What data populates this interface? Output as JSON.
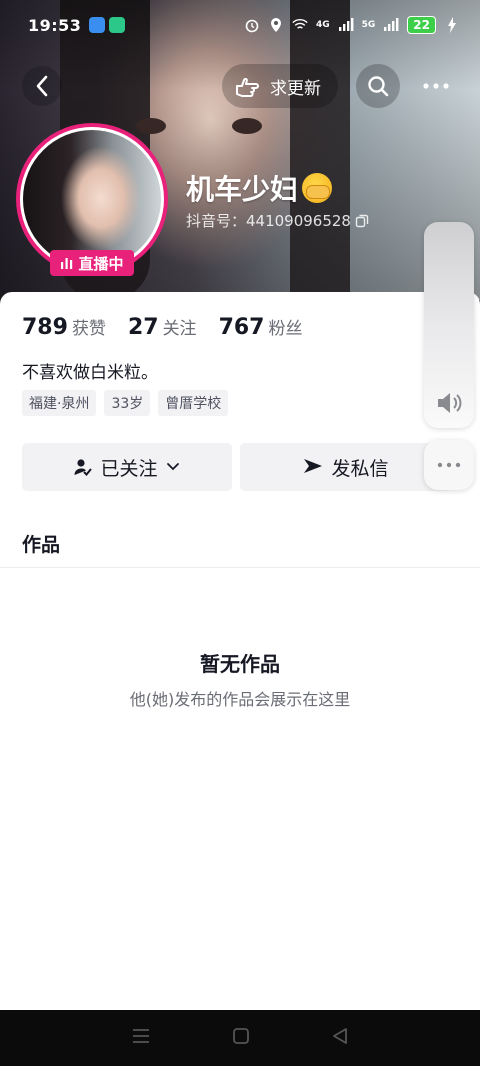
{
  "status_bar": {
    "time": "19:53",
    "battery": "22",
    "network_a": "4G",
    "network_b": "5G"
  },
  "nav": {
    "update_label": "求更新"
  },
  "profile": {
    "live_badge": "直播中",
    "nickname": "机车少妇",
    "douyin_id": "抖音号：44109096528"
  },
  "stats": [
    {
      "num": "789",
      "label": "获赞"
    },
    {
      "num": "27",
      "label": "关注"
    },
    {
      "num": "767",
      "label": "粉丝"
    }
  ],
  "bio": "不喜欢做白米粒。",
  "tags": [
    "福建·泉州",
    "33岁",
    "曾厝学校"
  ],
  "actions": {
    "follow_label": "已关注",
    "message_label": "发私信"
  },
  "works": {
    "tab_label": "作品",
    "empty_title": "暂无作品",
    "empty_subtitle": "他(她)发布的作品会展示在这里"
  },
  "colors": {
    "accent": "#e8217a",
    "battery": "#3ecf4a"
  }
}
